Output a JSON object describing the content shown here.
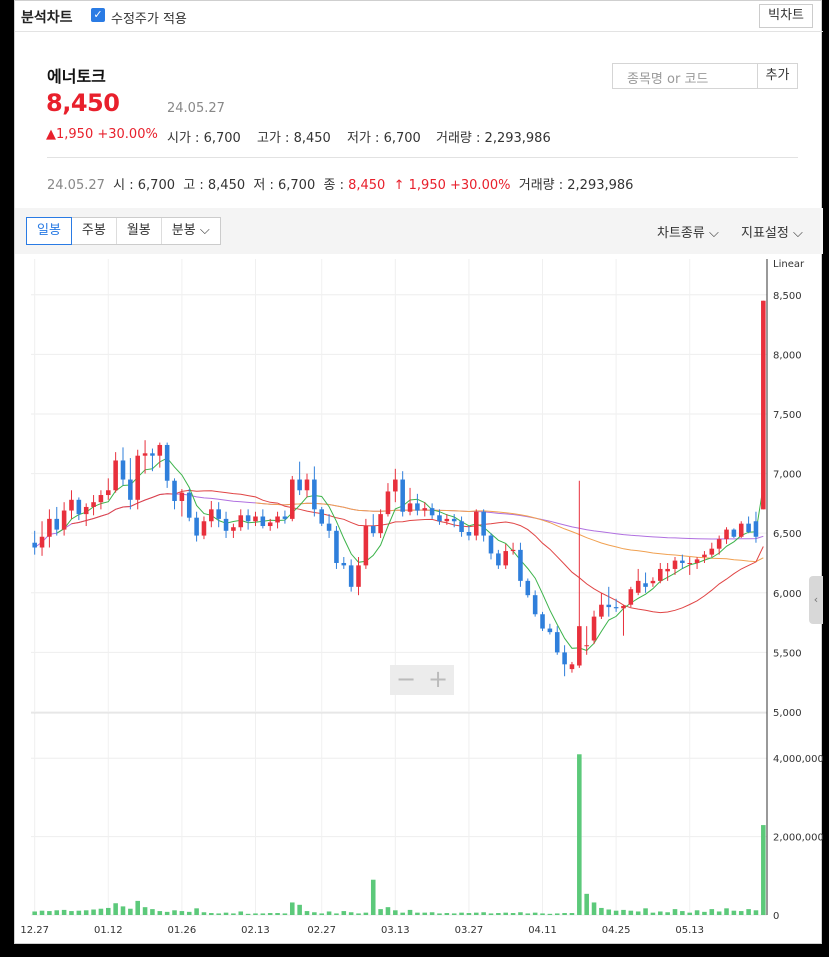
{
  "topbar": {
    "title": "분석차트",
    "adjusted_label": "수정주가 적용",
    "big_chart_button": "빅차트"
  },
  "stock": {
    "name": "에너토크",
    "price": "8,450",
    "date": "24.05.27",
    "change": "1,950",
    "change_pct": "+30.00%",
    "open_label": "시가",
    "open": "6,700",
    "high_label": "고가",
    "high": "8,450",
    "low_label": "저가",
    "low": "6,700",
    "volume_label": "거래량",
    "volume": "2,293,986"
  },
  "search": {
    "placeholder": "종목명 or 코드",
    "add_label": "추가"
  },
  "summary": {
    "date": "24.05.27",
    "open_label": "시",
    "open": "6,700",
    "high_label": "고",
    "high": "8,450",
    "low_label": "저",
    "low": "6,700",
    "close_label": "종",
    "close": "8,450",
    "change": "1,950",
    "change_pct": "+30.00%",
    "volume_label": "거래량",
    "volume": "2,293,986"
  },
  "toolbar": {
    "tabs": [
      "일봉",
      "주봉",
      "월봉",
      "분봉"
    ],
    "chart_type": "차트종류",
    "indicator": "지표설정"
  },
  "zoom": {
    "minus": "−",
    "plus": "+"
  },
  "colors": {
    "up": "#e8303c",
    "down": "#2f7fdb",
    "ma5": "#3cb34a",
    "ma20": "#e04545",
    "ma60": "#f0a050",
    "ma120": "#b070e0",
    "volume": "#5cc97a"
  },
  "chart_data": {
    "type": "candlestick",
    "scale_label": "Linear",
    "price_ticks": [
      5000,
      5500,
      6000,
      6500,
      7000,
      7500,
      8000,
      8500
    ],
    "price_tick_labels": [
      "5,000",
      "5,500",
      "6,000",
      "6,500",
      "7,000",
      "7,500",
      "8,000",
      "8,500"
    ],
    "volume_ticks": [
      0,
      2000000,
      4000000
    ],
    "volume_tick_labels": [
      "0",
      "2,000,000",
      "4,000,000"
    ],
    "ylim": [
      5000,
      8800
    ],
    "volume_max": 5000000,
    "date_labels": [
      "12.27",
      "01.12",
      "01.26",
      "02.13",
      "02.27",
      "03.13",
      "03.27",
      "04.11",
      "04.25",
      "05.13"
    ],
    "date_label_index": [
      0,
      10,
      20,
      30,
      39,
      49,
      59,
      69,
      79,
      89
    ],
    "ohlc": [
      [
        6420,
        6520,
        6320,
        6380
      ],
      [
        6380,
        6600,
        6310,
        6470
      ],
      [
        6470,
        6700,
        6380,
        6620
      ],
      [
        6620,
        6720,
        6480,
        6530
      ],
      [
        6530,
        6760,
        6480,
        6690
      ],
      [
        6690,
        6860,
        6620,
        6780
      ],
      [
        6780,
        6800,
        6610,
        6660
      ],
      [
        6660,
        6750,
        6560,
        6720
      ],
      [
        6720,
        6820,
        6650,
        6760
      ],
      [
        6760,
        6860,
        6700,
        6820
      ],
      [
        6820,
        6960,
        6780,
        6860
      ],
      [
        6860,
        7180,
        6840,
        7110
      ],
      [
        7110,
        7220,
        6900,
        6950
      ],
      [
        6950,
        7130,
        6700,
        6780
      ],
      [
        6780,
        7200,
        6700,
        7150
      ],
      [
        7150,
        7280,
        7000,
        7170
      ],
      [
        7170,
        7210,
        7020,
        7150
      ],
      [
        7150,
        7260,
        7050,
        7240
      ],
      [
        7240,
        7260,
        6880,
        6940
      ],
      [
        6940,
        6960,
        6700,
        6770
      ],
      [
        6770,
        6870,
        6640,
        6840
      ],
      [
        6840,
        6870,
        6600,
        6630
      ],
      [
        6630,
        6680,
        6430,
        6480
      ],
      [
        6480,
        6640,
        6450,
        6600
      ],
      [
        6600,
        6770,
        6550,
        6700
      ],
      [
        6700,
        6760,
        6550,
        6620
      ],
      [
        6620,
        6680,
        6460,
        6520
      ],
      [
        6520,
        6580,
        6460,
        6550
      ],
      [
        6550,
        6700,
        6520,
        6650
      ],
      [
        6650,
        6700,
        6530,
        6600
      ],
      [
        6600,
        6680,
        6560,
        6640
      ],
      [
        6640,
        6700,
        6540,
        6560
      ],
      [
        6560,
        6620,
        6520,
        6590
      ],
      [
        6590,
        6680,
        6540,
        6640
      ],
      [
        6640,
        6690,
        6580,
        6620
      ],
      [
        6620,
        6980,
        6600,
        6950
      ],
      [
        6950,
        7100,
        6820,
        6860
      ],
      [
        6860,
        7000,
        6800,
        6950
      ],
      [
        6950,
        7060,
        6640,
        6700
      ],
      [
        6700,
        6720,
        6560,
        6580
      ],
      [
        6580,
        6660,
        6460,
        6520
      ],
      [
        6520,
        6560,
        6200,
        6250
      ],
      [
        6250,
        6300,
        6200,
        6230
      ],
      [
        6230,
        6280,
        6010,
        6050
      ],
      [
        6050,
        6300,
        5980,
        6230
      ],
      [
        6230,
        6620,
        6200,
        6560
      ],
      [
        6560,
        6660,
        6470,
        6500
      ],
      [
        6500,
        6700,
        6460,
        6660
      ],
      [
        6660,
        6920,
        6640,
        6850
      ],
      [
        6850,
        7040,
        6760,
        6950
      ],
      [
        6950,
        7020,
        6640,
        6680
      ],
      [
        6680,
        6880,
        6650,
        6750
      ],
      [
        6750,
        6830,
        6650,
        6690
      ],
      [
        6690,
        6760,
        6640,
        6710
      ],
      [
        6710,
        6750,
        6620,
        6650
      ],
      [
        6650,
        6700,
        6570,
        6600
      ],
      [
        6600,
        6660,
        6570,
        6620
      ],
      [
        6620,
        6660,
        6550,
        6600
      ],
      [
        6600,
        6640,
        6470,
        6510
      ],
      [
        6510,
        6560,
        6440,
        6480
      ],
      [
        6480,
        6700,
        6440,
        6680
      ],
      [
        6680,
        6700,
        6430,
        6480
      ],
      [
        6480,
        6500,
        6280,
        6330
      ],
      [
        6330,
        6360,
        6200,
        6230
      ],
      [
        6230,
        6410,
        6200,
        6350
      ],
      [
        6350,
        6420,
        6320,
        6360
      ],
      [
        6360,
        6420,
        6050,
        6100
      ],
      [
        6100,
        6120,
        5960,
        5980
      ],
      [
        5980,
        6020,
        5800,
        5820
      ],
      [
        5820,
        5840,
        5680,
        5700
      ],
      [
        5700,
        5740,
        5650,
        5670
      ],
      [
        5670,
        5720,
        5480,
        5500
      ],
      [
        5500,
        5560,
        5300,
        5400
      ],
      [
        5360,
        5420,
        5330,
        5400
      ],
      [
        5390,
        6940,
        5370,
        5720
      ],
      [
        5560,
        5720,
        5480,
        5560
      ],
      [
        5600,
        5850,
        5570,
        5800
      ],
      [
        5800,
        6000,
        5780,
        5900
      ],
      [
        5900,
        6050,
        5800,
        5880
      ],
      [
        5880,
        5950,
        5840,
        5870
      ],
      [
        5870,
        5900,
        5640,
        5890
      ],
      [
        5900,
        6050,
        5880,
        6030
      ],
      [
        6000,
        6200,
        5980,
        6100
      ],
      [
        6080,
        6170,
        6000,
        6050
      ],
      [
        6080,
        6130,
        6050,
        6100
      ],
      [
        6100,
        6250,
        6080,
        6200
      ],
      [
        6180,
        6250,
        6100,
        6200
      ],
      [
        6200,
        6300,
        6150,
        6270
      ],
      [
        6270,
        6320,
        6200,
        6250
      ],
      [
        6250,
        6300,
        6150,
        6250
      ],
      [
        6250,
        6300,
        6200,
        6280
      ],
      [
        6300,
        6350,
        6250,
        6320
      ],
      [
        6320,
        6420,
        6300,
        6370
      ],
      [
        6370,
        6480,
        6320,
        6450
      ],
      [
        6450,
        6550,
        6410,
        6530
      ],
      [
        6530,
        6540,
        6460,
        6470
      ],
      [
        6470,
        6600,
        6460,
        6580
      ],
      [
        6580,
        6640,
        6500,
        6510
      ],
      [
        6600,
        6680,
        6420,
        6470
      ],
      [
        6700,
        8450,
        6700,
        8450
      ]
    ],
    "volume": [
      90000,
      110000,
      100000,
      120000,
      130000,
      100000,
      110000,
      120000,
      140000,
      160000,
      180000,
      300000,
      220000,
      160000,
      360000,
      200000,
      150000,
      100000,
      80000,
      120000,
      100000,
      80000,
      170000,
      70000,
      50000,
      40000,
      60000,
      40000,
      90000,
      30000,
      40000,
      40000,
      50000,
      50000,
      40000,
      320000,
      260000,
      100000,
      70000,
      40000,
      90000,
      40000,
      100000,
      70000,
      40000,
      60000,
      900000,
      150000,
      200000,
      120000,
      60000,
      130000,
      60000,
      60000,
      70000,
      40000,
      50000,
      40000,
      60000,
      50000,
      60000,
      70000,
      40000,
      50000,
      60000,
      50000,
      70000,
      40000,
      60000,
      40000,
      30000,
      40000,
      50000,
      50000,
      4100000,
      540000,
      320000,
      180000,
      140000,
      110000,
      130000,
      110000,
      90000,
      170000,
      60000,
      90000,
      70000,
      150000,
      100000,
      60000,
      120000,
      80000,
      150000,
      90000,
      170000,
      110000,
      100000,
      150000,
      120000,
      2293986
    ]
  }
}
